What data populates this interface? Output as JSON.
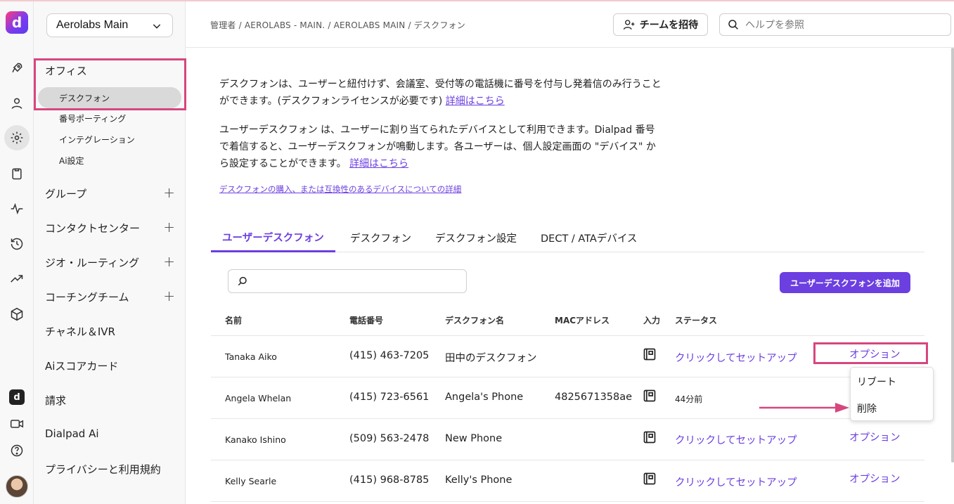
{
  "header": {
    "breadcrumb": "管理者 / AEROLABS - MAIN. / AEROLABS MAIN / デスクフォン",
    "invite_label": "チームを招待",
    "help_placeholder": "ヘルプを参照"
  },
  "sidebar": {
    "org": "Aerolabs Main",
    "office": "オフィス",
    "office_sub": [
      "デスクフォン",
      "番号ポーティング",
      "インテグレーション",
      "Ai設定"
    ],
    "sections": [
      "グループ",
      "コンタクトセンター",
      "ジオ・ルーティング",
      "コーチングチーム",
      "チャネル＆IVR",
      "Aiスコアカード",
      "請求",
      "Dialpad Ai",
      "プライバシーと利用規約"
    ]
  },
  "intro": {
    "p1": "デスクフォンは、ユーザーと紐付けず、会議室、受付等の電話機に番号を付与し発着信のみ行うことができます。(デスクフォンライセンスが必要です)",
    "p1_link": "詳細はこちら",
    "p2": "ユーザーデスクフォン は、ユーザーに割り当てられたデバイスとして利用できます。Dialpad 番号で着信すると、ユーザーデスクフォンが鳴動します。各ユーザーは、個人設定画面の \"デバイス\" から設定することができます。",
    "p2_link": "詳細はこちら",
    "purchase_link": "デスクフォンの購入、または互換性のあるデバイスについての詳細"
  },
  "tabs": [
    "ユーザーデスクフォン",
    "デスクフォン",
    "デスクフォン設定",
    "DECT / ATAデバイス"
  ],
  "add_button": "ユーザーデスクフォンを追加",
  "table": {
    "headers": [
      "名前",
      "電話番号",
      "デスクフォン名",
      "MACアドレス",
      "入力",
      "ステータス"
    ],
    "rows": [
      {
        "name": "Tanaka Aiko",
        "phone": "(415) 463-7205",
        "desk": "田中のデスクフォン",
        "mac": "",
        "status": "クリックしてセットアップ",
        "option": "オプション"
      },
      {
        "name": "Angela Whelan",
        "phone": "(415) 723-6561",
        "desk": "Angela's Phone",
        "mac": "4825671358ae",
        "status": "44分前",
        "option": ""
      },
      {
        "name": "Kanako Ishino",
        "phone": "(509) 563-2478",
        "desk": "New Phone",
        "mac": "",
        "status": "クリックしてセットアップ",
        "option": "オプション"
      },
      {
        "name": "Kelly Searle",
        "phone": "(415) 968-8785",
        "desk": "Kelly's Phone",
        "mac": "",
        "status": "クリックしてセットアップ",
        "option": "オプション"
      }
    ]
  },
  "menu": [
    "リブート",
    "削除"
  ],
  "colors": {
    "accent": "#6c3fe0",
    "highlight": "#d7467f"
  }
}
